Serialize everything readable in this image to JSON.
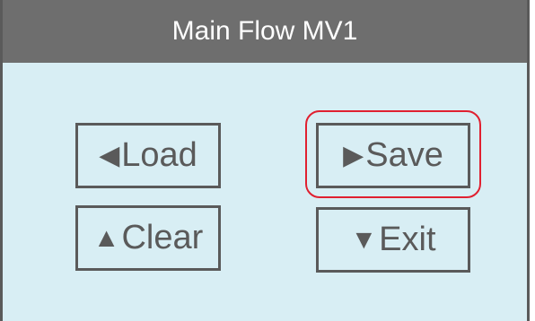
{
  "window": {
    "title": "Main Flow MV1"
  },
  "buttons": {
    "load": {
      "glyph": "◀",
      "label": "Load"
    },
    "save": {
      "glyph": "▶",
      "label": "Save"
    },
    "clear": {
      "glyph": "▲",
      "label": "Clear"
    },
    "exit": {
      "glyph": "▼",
      "label": "Exit"
    }
  },
  "colors": {
    "title_bar": "#6e6e6e",
    "screen_background": "#d8eef4",
    "button_border": "#5a5a5a",
    "highlight": "#e02030"
  },
  "icons": {
    "load": "left-triangle-icon",
    "save": "right-triangle-icon",
    "clear": "up-triangle-icon",
    "exit": "down-triangle-icon"
  }
}
